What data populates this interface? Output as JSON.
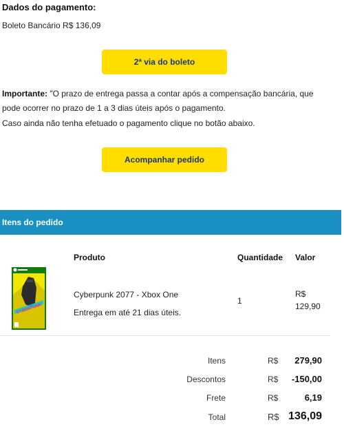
{
  "payment": {
    "title": "Dados do pagamento:",
    "method": "Boleto Bancário R$ 136,09",
    "boleto_button": "2ª via do boleto",
    "important_label": "Importante:",
    "important_text": " \"O prazo de entrega passa a contar após a compensação bancária, que pode ocorrer no prazo de 1 a 3 dias úteis após o pagamento.",
    "hint": "Caso ainda não tenha efetuado o pagamento clique no botão abaixo.",
    "track_button": "Acompanhar pedido"
  },
  "items": {
    "section_title": "Itens do pedido",
    "headers": {
      "product": "Produto",
      "quantity": "Quantidade",
      "value": "Valor"
    },
    "product": {
      "name": "Cyberpunk 2077 - Xbox One",
      "delivery": "Entrega em até 21 dias úteis.",
      "quantity": "1",
      "currency": "R$",
      "value": "129,90",
      "image_icon": "game-box-cover-icon",
      "cover_text": "CYBERPUNK"
    }
  },
  "totals": {
    "rows": [
      {
        "label": "Itens",
        "currency": "R$",
        "value": "279,90"
      },
      {
        "label": "Descontos",
        "currency": "R$",
        "value": "-150,00"
      },
      {
        "label": "Frete",
        "currency": "R$",
        "value": "6,19"
      },
      {
        "label": "Total",
        "currency": "R$",
        "value": "136,09"
      }
    ]
  },
  "colors": {
    "button_yellow": "#ffdd00",
    "header_blue": "#1a8fc1",
    "xbox_green": "#107c10",
    "button_text": "#1a3a6b"
  }
}
